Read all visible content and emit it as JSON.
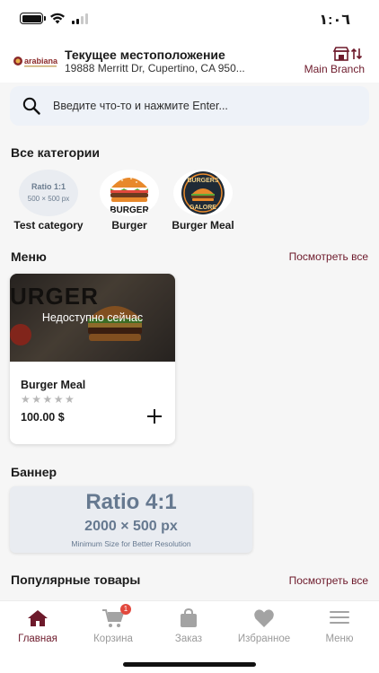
{
  "status_bar": {
    "time": "١:٠٦"
  },
  "header": {
    "title": "Текущее местоположение",
    "address": "19888 Merritt Dr, Cupertino, CA 950...",
    "branch_label": "Main Branch",
    "logo_text": "arabiana"
  },
  "search": {
    "placeholder": "Введите что-то и нажмите Enter..."
  },
  "categories": {
    "title": "Все категории",
    "placeholder_ratio": "Ratio 1:1",
    "placeholder_size": "500 × 500 px",
    "items": [
      {
        "label": "Test category"
      },
      {
        "label": "Burger"
      },
      {
        "label": "Burger Meal"
      }
    ],
    "icon_texts": {
      "burger": "BURGER",
      "meal_top": "BURGERS",
      "meal_bottom": "GALORE"
    }
  },
  "menu": {
    "title": "Меню",
    "view_all": "Посмотреть все",
    "product": {
      "image_text": "URGER",
      "unavailable": "Недоступно сейчас",
      "name": "Burger Meal",
      "rating": 0,
      "stars": "★★★★★",
      "price": "100.00 $"
    }
  },
  "banner": {
    "title": "Баннер",
    "ratio": "Ratio 4:1",
    "size": "2000 × 500 px",
    "note": "Minimum Size for Better Resolution"
  },
  "popular": {
    "title": "Популярные товары",
    "view_all": "Посмотреть все"
  },
  "tabs": [
    {
      "label": "Главная",
      "active": true
    },
    {
      "label": "Корзина",
      "badge": "1"
    },
    {
      "label": "Заказ"
    },
    {
      "label": "Избранное"
    },
    {
      "label": "Меню"
    }
  ],
  "colors": {
    "accent": "#6d1a2b",
    "badge": "#e2483d",
    "inactive": "#9a9a9a",
    "search_bg": "#eef2f8"
  }
}
